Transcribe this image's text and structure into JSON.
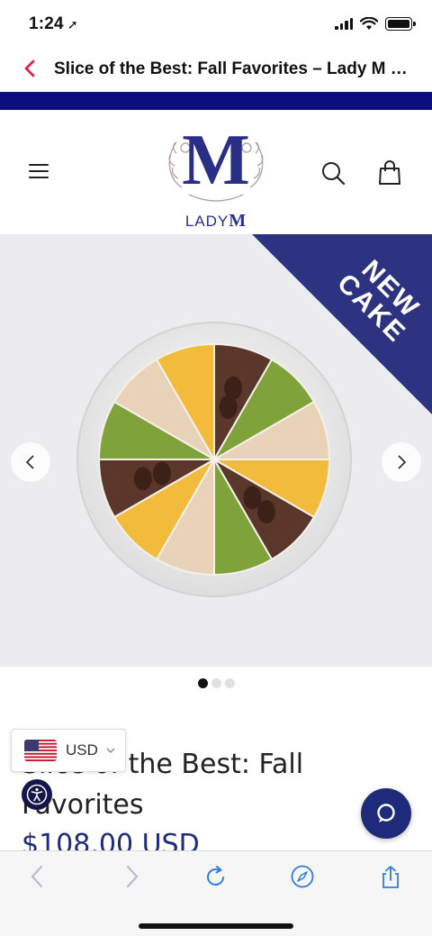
{
  "status_bar": {
    "time": "1:24",
    "location_glyph": "➚"
  },
  "browser": {
    "page_title": "Slice of the Best: Fall Favorites – Lady M C..."
  },
  "header": {
    "logo_text_light": "LADY",
    "logo_text_bold": "M",
    "logo_monogram": "M"
  },
  "gallery": {
    "badge_line1": "NEW",
    "badge_line2": "CAKE",
    "slides_total": 3,
    "active_slide": 1
  },
  "product": {
    "title_line1": "Slice of the Best: Fall",
    "title_line2": "Favorites",
    "price": "$108.00 USD"
  },
  "currency_selector": {
    "code": "USD"
  },
  "colors": {
    "brand_navy": "#2a2f86",
    "promo_bar": "#0b0f7d",
    "badge": "#2d3380",
    "price": "#1e2a7a",
    "back_accent": "#e0244a"
  },
  "icons": [
    "location-arrow-icon",
    "signal-icon",
    "wifi-icon",
    "battery-icon",
    "back-chevron-icon",
    "menu-icon",
    "search-icon",
    "bag-icon",
    "chevron-left-icon",
    "chevron-right-icon",
    "accessibility-icon",
    "chat-icon",
    "safari-back-icon",
    "safari-forward-icon",
    "reload-icon",
    "compass-icon",
    "share-icon"
  ]
}
